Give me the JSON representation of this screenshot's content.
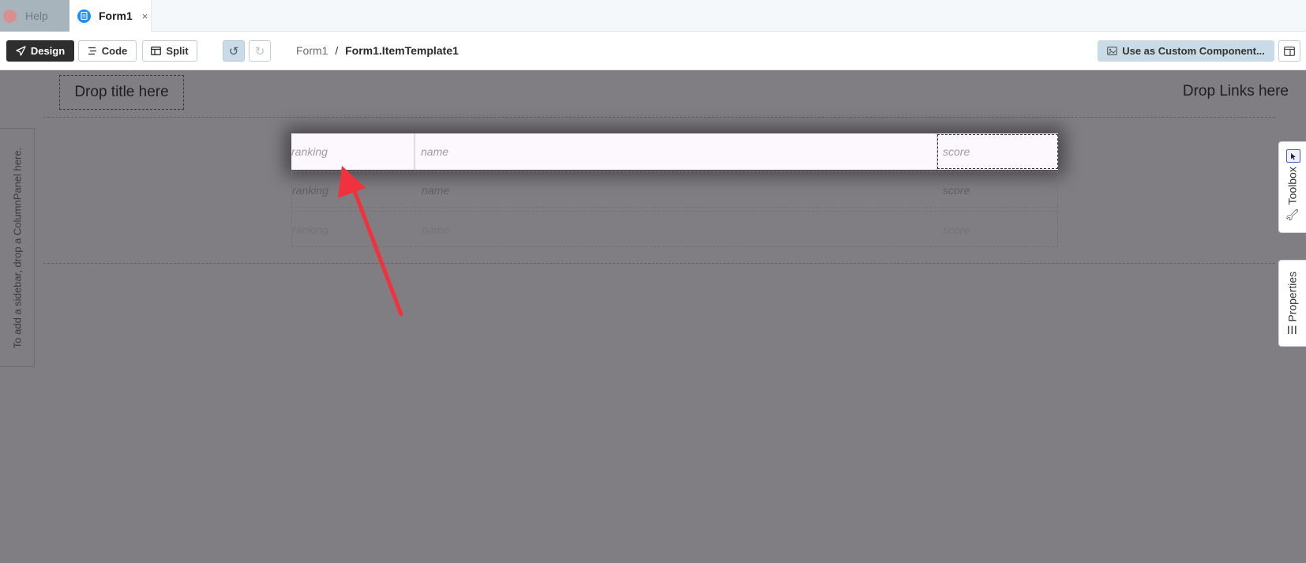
{
  "tabs": [
    {
      "label": "Help"
    },
    {
      "label": "Form1",
      "close": "×"
    }
  ],
  "toolbar": {
    "design_label": "Design",
    "code_label": "Code",
    "split_label": "Split",
    "undo_glyph": "↺",
    "redo_glyph": "↻",
    "breadcrumb_root": "Form1",
    "breadcrumb_sep": "/",
    "breadcrumb_current": "Form1.ItemTemplate1",
    "custom_component_label": "Use as Custom Component..."
  },
  "canvas": {
    "drop_title": "Drop title here",
    "drop_links": "Drop Links here",
    "sidebar_hint": "To add a sidebar, drop a ColumnPanel here."
  },
  "repeating_panel": {
    "columns": [
      "ranking",
      "name",
      "score"
    ],
    "rows": [
      [
        "ranking",
        "name",
        "score"
      ],
      [
        "ranking",
        "name",
        "score"
      ],
      [
        "ranking",
        "name",
        "score"
      ]
    ]
  },
  "right_rail": {
    "toolbox_label": "Toolbox",
    "properties_label": "Properties"
  },
  "colors": {
    "accent_blue": "#1f8ff0",
    "annotation_arrow": "#f0323e",
    "canvas_overlay": "#807e82"
  },
  "icons": [
    "help-icon",
    "form-icon",
    "close-icon",
    "send-icon",
    "code-icon",
    "split-icon",
    "undo-icon",
    "redo-icon",
    "custom-component-icon",
    "panel-toggle-icon",
    "pointer-icon",
    "wrench-icon",
    "sliders-icon"
  ]
}
